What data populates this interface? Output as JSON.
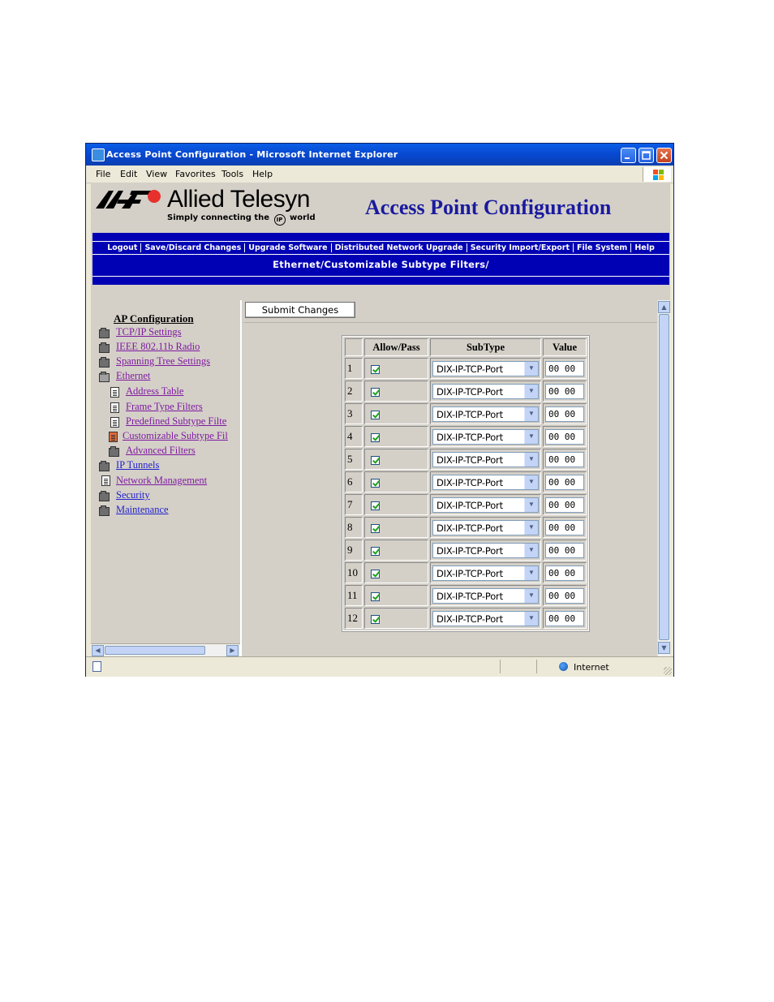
{
  "window": {
    "title": "Access Point Configuration - Microsoft Internet Explorer",
    "controls": [
      "minimize",
      "maximize",
      "close"
    ]
  },
  "menu": [
    "File",
    "Edit",
    "View",
    "Favorites",
    "Tools",
    "Help"
  ],
  "brand": {
    "name": "Allied Telesyn",
    "tagline_pre": "Simply connecting the",
    "tagline_ip": "IP",
    "tagline_post": "world"
  },
  "page_heading": "Access Point Configuration",
  "nav": [
    "Logout",
    "Save/Discard Changes",
    "Upgrade Software",
    "Distributed Network Upgrade",
    "Security Import/Export",
    "File System",
    "Help"
  ],
  "breadcrumb": "Ethernet/Customizable Subtype Filters/",
  "tree": {
    "root": "AP Configuration",
    "items": [
      {
        "label": "TCP/IP Settings",
        "icon": "folder-icon",
        "level": 0,
        "visited": true
      },
      {
        "label": "IEEE 802.11b Radio",
        "icon": "folder-icon",
        "level": 0,
        "visited": true
      },
      {
        "label": "Spanning Tree Settings",
        "icon": "folder-icon",
        "level": 0,
        "visited": true
      },
      {
        "label": "Ethernet",
        "icon": "folder-open-icon",
        "level": 0,
        "visited": true
      },
      {
        "label": "Address Table",
        "icon": "page-icon",
        "level": 1,
        "visited": true
      },
      {
        "label": "Frame Type Filters",
        "icon": "page-icon",
        "level": 1,
        "visited": true
      },
      {
        "label": "Predefined Subtype Filte",
        "icon": "page-icon",
        "level": 1,
        "visited": true
      },
      {
        "label": "Customizable Subtype Fil",
        "icon": "page-selected-icon",
        "level": 1,
        "visited": true
      },
      {
        "label": "Advanced Filters",
        "icon": "folder-icon",
        "level": 1,
        "visited": true
      },
      {
        "label": "IP Tunnels",
        "icon": "folder-icon",
        "level": 0,
        "visited": false
      },
      {
        "label": "Network Management",
        "icon": "page-icon",
        "level": 0,
        "visited": true
      },
      {
        "label": "Security",
        "icon": "folder-icon",
        "level": 0,
        "visited": false
      },
      {
        "label": "Maintenance",
        "icon": "folder-icon",
        "level": 0,
        "visited": false
      }
    ]
  },
  "submit_label": "Submit Changes",
  "table": {
    "headers": [
      "Allow/Pass",
      "SubType",
      "Value"
    ],
    "rows": [
      {
        "num": "1",
        "allow": true,
        "subtype": "DIX-IP-TCP-Port",
        "value": "00 00"
      },
      {
        "num": "2",
        "allow": true,
        "subtype": "DIX-IP-TCP-Port",
        "value": "00 00"
      },
      {
        "num": "3",
        "allow": true,
        "subtype": "DIX-IP-TCP-Port",
        "value": "00 00"
      },
      {
        "num": "4",
        "allow": true,
        "subtype": "DIX-IP-TCP-Port",
        "value": "00 00"
      },
      {
        "num": "5",
        "allow": true,
        "subtype": "DIX-IP-TCP-Port",
        "value": "00 00"
      },
      {
        "num": "6",
        "allow": true,
        "subtype": "DIX-IP-TCP-Port",
        "value": "00 00"
      },
      {
        "num": "7",
        "allow": true,
        "subtype": "DIX-IP-TCP-Port",
        "value": "00 00"
      },
      {
        "num": "8",
        "allow": true,
        "subtype": "DIX-IP-TCP-Port",
        "value": "00 00"
      },
      {
        "num": "9",
        "allow": true,
        "subtype": "DIX-IP-TCP-Port",
        "value": "00 00"
      },
      {
        "num": "10",
        "allow": true,
        "subtype": "DIX-IP-TCP-Port",
        "value": "00 00"
      },
      {
        "num": "11",
        "allow": true,
        "subtype": "DIX-IP-TCP-Port",
        "value": "00 00"
      },
      {
        "num": "12",
        "allow": true,
        "subtype": "DIX-IP-TCP-Port",
        "value": "00 00"
      }
    ]
  },
  "status": {
    "zone": "Internet"
  },
  "colors": {
    "nav_blue": "#0000b4",
    "heading_blue": "#1a1a9f",
    "link": "#2222cc",
    "visited_link": "#7f1aa0",
    "brand_red": "#e8312d"
  }
}
